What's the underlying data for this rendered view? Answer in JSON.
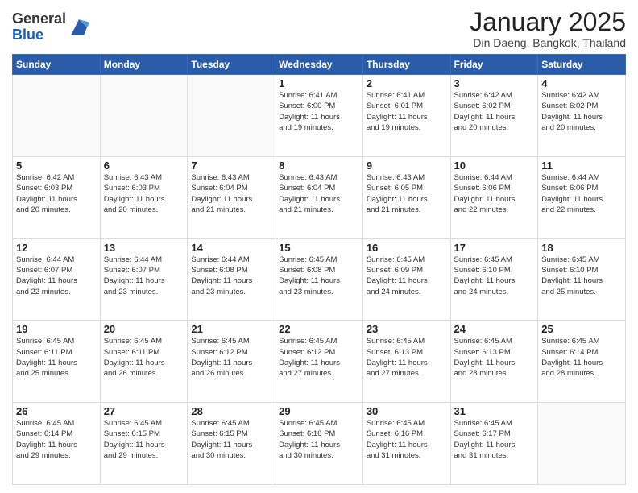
{
  "logo": {
    "general": "General",
    "blue": "Blue"
  },
  "header": {
    "month": "January 2025",
    "location": "Din Daeng, Bangkok, Thailand"
  },
  "weekdays": [
    "Sunday",
    "Monday",
    "Tuesday",
    "Wednesday",
    "Thursday",
    "Friday",
    "Saturday"
  ],
  "weeks": [
    [
      {
        "day": "",
        "info": ""
      },
      {
        "day": "",
        "info": ""
      },
      {
        "day": "",
        "info": ""
      },
      {
        "day": "1",
        "info": "Sunrise: 6:41 AM\nSunset: 6:00 PM\nDaylight: 11 hours\nand 19 minutes."
      },
      {
        "day": "2",
        "info": "Sunrise: 6:41 AM\nSunset: 6:01 PM\nDaylight: 11 hours\nand 19 minutes."
      },
      {
        "day": "3",
        "info": "Sunrise: 6:42 AM\nSunset: 6:02 PM\nDaylight: 11 hours\nand 20 minutes."
      },
      {
        "day": "4",
        "info": "Sunrise: 6:42 AM\nSunset: 6:02 PM\nDaylight: 11 hours\nand 20 minutes."
      }
    ],
    [
      {
        "day": "5",
        "info": "Sunrise: 6:42 AM\nSunset: 6:03 PM\nDaylight: 11 hours\nand 20 minutes."
      },
      {
        "day": "6",
        "info": "Sunrise: 6:43 AM\nSunset: 6:03 PM\nDaylight: 11 hours\nand 20 minutes."
      },
      {
        "day": "7",
        "info": "Sunrise: 6:43 AM\nSunset: 6:04 PM\nDaylight: 11 hours\nand 21 minutes."
      },
      {
        "day": "8",
        "info": "Sunrise: 6:43 AM\nSunset: 6:04 PM\nDaylight: 11 hours\nand 21 minutes."
      },
      {
        "day": "9",
        "info": "Sunrise: 6:43 AM\nSunset: 6:05 PM\nDaylight: 11 hours\nand 21 minutes."
      },
      {
        "day": "10",
        "info": "Sunrise: 6:44 AM\nSunset: 6:06 PM\nDaylight: 11 hours\nand 22 minutes."
      },
      {
        "day": "11",
        "info": "Sunrise: 6:44 AM\nSunset: 6:06 PM\nDaylight: 11 hours\nand 22 minutes."
      }
    ],
    [
      {
        "day": "12",
        "info": "Sunrise: 6:44 AM\nSunset: 6:07 PM\nDaylight: 11 hours\nand 22 minutes."
      },
      {
        "day": "13",
        "info": "Sunrise: 6:44 AM\nSunset: 6:07 PM\nDaylight: 11 hours\nand 23 minutes."
      },
      {
        "day": "14",
        "info": "Sunrise: 6:44 AM\nSunset: 6:08 PM\nDaylight: 11 hours\nand 23 minutes."
      },
      {
        "day": "15",
        "info": "Sunrise: 6:45 AM\nSunset: 6:08 PM\nDaylight: 11 hours\nand 23 minutes."
      },
      {
        "day": "16",
        "info": "Sunrise: 6:45 AM\nSunset: 6:09 PM\nDaylight: 11 hours\nand 24 minutes."
      },
      {
        "day": "17",
        "info": "Sunrise: 6:45 AM\nSunset: 6:10 PM\nDaylight: 11 hours\nand 24 minutes."
      },
      {
        "day": "18",
        "info": "Sunrise: 6:45 AM\nSunset: 6:10 PM\nDaylight: 11 hours\nand 25 minutes."
      }
    ],
    [
      {
        "day": "19",
        "info": "Sunrise: 6:45 AM\nSunset: 6:11 PM\nDaylight: 11 hours\nand 25 minutes."
      },
      {
        "day": "20",
        "info": "Sunrise: 6:45 AM\nSunset: 6:11 PM\nDaylight: 11 hours\nand 26 minutes."
      },
      {
        "day": "21",
        "info": "Sunrise: 6:45 AM\nSunset: 6:12 PM\nDaylight: 11 hours\nand 26 minutes."
      },
      {
        "day": "22",
        "info": "Sunrise: 6:45 AM\nSunset: 6:12 PM\nDaylight: 11 hours\nand 27 minutes."
      },
      {
        "day": "23",
        "info": "Sunrise: 6:45 AM\nSunset: 6:13 PM\nDaylight: 11 hours\nand 27 minutes."
      },
      {
        "day": "24",
        "info": "Sunrise: 6:45 AM\nSunset: 6:13 PM\nDaylight: 11 hours\nand 28 minutes."
      },
      {
        "day": "25",
        "info": "Sunrise: 6:45 AM\nSunset: 6:14 PM\nDaylight: 11 hours\nand 28 minutes."
      }
    ],
    [
      {
        "day": "26",
        "info": "Sunrise: 6:45 AM\nSunset: 6:14 PM\nDaylight: 11 hours\nand 29 minutes."
      },
      {
        "day": "27",
        "info": "Sunrise: 6:45 AM\nSunset: 6:15 PM\nDaylight: 11 hours\nand 29 minutes."
      },
      {
        "day": "28",
        "info": "Sunrise: 6:45 AM\nSunset: 6:15 PM\nDaylight: 11 hours\nand 30 minutes."
      },
      {
        "day": "29",
        "info": "Sunrise: 6:45 AM\nSunset: 6:16 PM\nDaylight: 11 hours\nand 30 minutes."
      },
      {
        "day": "30",
        "info": "Sunrise: 6:45 AM\nSunset: 6:16 PM\nDaylight: 11 hours\nand 31 minutes."
      },
      {
        "day": "31",
        "info": "Sunrise: 6:45 AM\nSunset: 6:17 PM\nDaylight: 11 hours\nand 31 minutes."
      },
      {
        "day": "",
        "info": ""
      }
    ]
  ]
}
